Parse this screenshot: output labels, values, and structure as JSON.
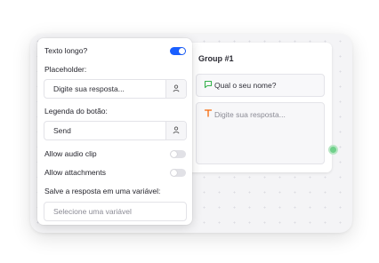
{
  "group": {
    "title": "Group #1",
    "question_block": "Qual o seu nome?",
    "input_block_placeholder": "Digite sua resposta..."
  },
  "settings": {
    "long_text_label": "Texto longo?",
    "long_text_on": true,
    "placeholder_label": "Placeholder:",
    "placeholder_value": "Digite sua resposta...",
    "button_label_label": "Legenda do botão:",
    "button_label_value": "Send",
    "audio_clip_label": "Allow audio clip",
    "audio_clip_on": false,
    "attachments_label": "Allow attachments",
    "attachments_on": false,
    "save_variable_label": "Salve a resposta em uma variável:",
    "variable_placeholder": "Selecione uma variável"
  },
  "colors": {
    "accent": "#1a5fff",
    "question_icon": "#37b24d",
    "text_icon": "#f76707",
    "handle": "#6fd08a"
  },
  "icons": [
    "chat-bubble-icon",
    "text-t-icon",
    "user-variable-icon"
  ]
}
